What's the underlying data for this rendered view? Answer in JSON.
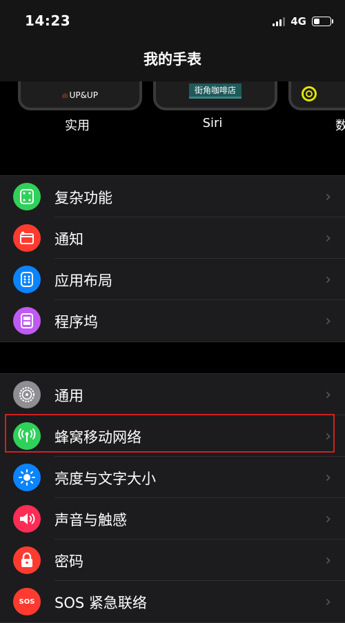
{
  "status": {
    "time": "14:23",
    "network": "4G",
    "battery_level": 0.45
  },
  "nav": {
    "title": "我的手表"
  },
  "faces": [
    {
      "label": "实用",
      "content": "UP&UP"
    },
    {
      "label": "Siri",
      "content": "街角咖啡店"
    },
    {
      "label": "数"
    }
  ],
  "group1": [
    {
      "label": "复杂功能",
      "color": "#30d158",
      "icon": "complications-icon"
    },
    {
      "label": "通知",
      "color": "#ff3b30",
      "icon": "notifications-icon"
    },
    {
      "label": "应用布局",
      "color": "#0a84ff",
      "icon": "app-layout-icon"
    },
    {
      "label": "程序坞",
      "color": "#bf5af2",
      "icon": "dock-icon"
    }
  ],
  "group2": [
    {
      "label": "通用",
      "color": "#8e8e93",
      "icon": "gear-icon"
    },
    {
      "label": "蜂窝移动网络",
      "color": "#30d158",
      "icon": "cellular-icon"
    },
    {
      "label": "亮度与文字大小",
      "color": "#0a84ff",
      "icon": "brightness-icon"
    },
    {
      "label": "声音与触感",
      "color": "#ff2d55",
      "icon": "sound-icon"
    },
    {
      "label": "密码",
      "color": "#ff3b30",
      "icon": "lock-icon"
    },
    {
      "label": "SOS 紧急联络",
      "color": "#ff3b30",
      "icon": "sos-icon"
    }
  ]
}
